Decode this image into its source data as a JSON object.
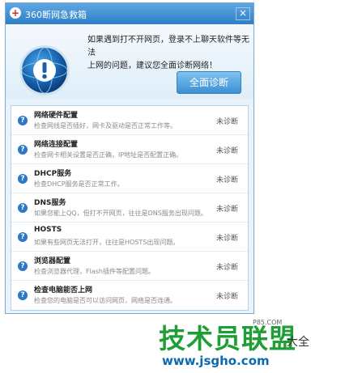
{
  "window": {
    "title": "360断网急救箱",
    "close_glyph": "×"
  },
  "header": {
    "message_line1": "如果遇到打不开网页，登录不上聊天软件等无法",
    "message_line2": "上网的问题，建议您全面诊断网络！",
    "diagnose_button": "全面诊断"
  },
  "checks": [
    {
      "name": "网络硬件配置",
      "desc": "检查网线是否插好，网卡及驱动是否正常工作等。",
      "status": "未诊断"
    },
    {
      "name": "网络连接配置",
      "desc": "检查网卡相关设置是否正确，IP地址是否配置正确。",
      "status": "未诊断"
    },
    {
      "name": "DHCP服务",
      "desc": "检查DHCP服务是否正常工作。",
      "status": "未诊断"
    },
    {
      "name": "DNS服务",
      "desc": "如果您能上QQ，但打不开网页，往往是DNS服务出现问题。",
      "status": "未诊断"
    },
    {
      "name": "HOSTS",
      "desc": "如果有些网页无法打开，往往是HOSTS出现问题。",
      "status": "未诊断"
    },
    {
      "name": "浏览器配置",
      "desc": "检查浏览器代理，Flash插件等配置问题。",
      "status": "未诊断"
    },
    {
      "name": "检查电脑能否上网",
      "desc": "检查您的电脑是否可以访问网页，网络是否连通。",
      "status": "未诊断"
    }
  ],
  "watermark": {
    "brand": "技术员联盟",
    "url": "www.jsgho.com",
    "side_text": "大全",
    "mid_text": "P85.COM"
  },
  "colors": {
    "title_bar": "#2e7dc6",
    "accent_blue": "#2b78c8",
    "watermark_green": "#1f9e35"
  },
  "icons": {
    "app": "360-logo-icon",
    "main": "warning-globe-icon",
    "row": "question-icon"
  }
}
